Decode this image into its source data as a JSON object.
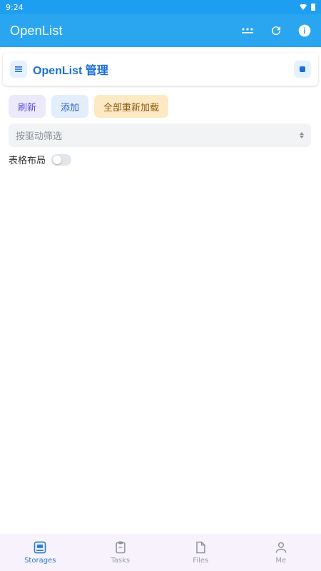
{
  "status_bar": {
    "time": "9:24"
  },
  "app_bar": {
    "title": "OpenList"
  },
  "header": {
    "title": "OpenList 管理"
  },
  "actions": {
    "refresh_label": "刷新",
    "add_label": "添加",
    "reload_all_label": "全部重新加载"
  },
  "filter": {
    "placeholder": "按驱动筛选"
  },
  "layout_toggle": {
    "label": "表格布局",
    "enabled": false
  },
  "bottom_nav": {
    "items": [
      {
        "label": "Storages",
        "icon": "storage-icon",
        "active": true
      },
      {
        "label": "Tasks",
        "icon": "clipboard-icon",
        "active": false
      },
      {
        "label": "Files",
        "icon": "file-icon",
        "active": false
      },
      {
        "label": "Me",
        "icon": "person-icon",
        "active": false
      }
    ]
  },
  "colors": {
    "primary": "#2aa6f0",
    "accent_blue": "#1b6fd8",
    "nav_active": "#2d7dd2"
  }
}
